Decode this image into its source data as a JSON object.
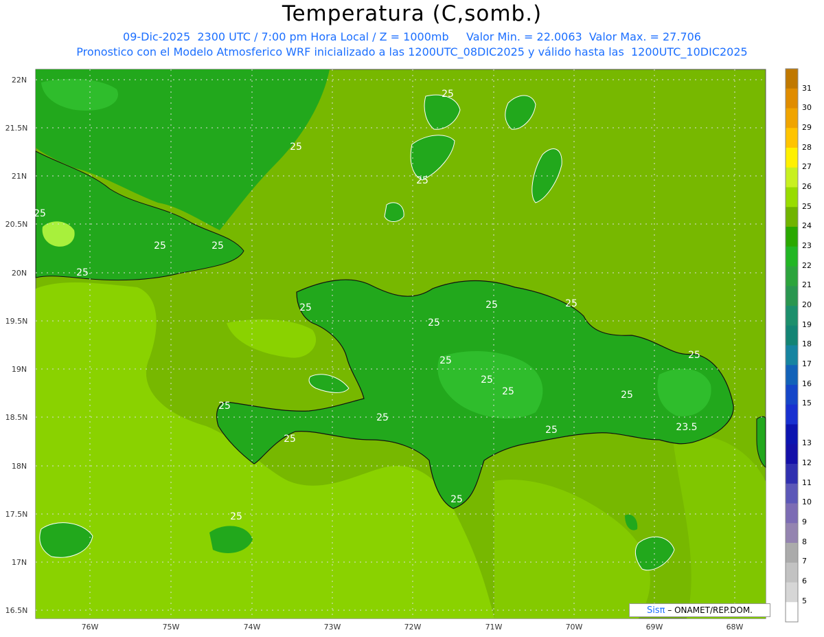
{
  "title": "Temperatura (C,somb.)",
  "subtitle_line1": "09-Dic-2025  2300 UTC / 7:00 pm Hora Local / Z = 1000mb     Valor Min. = 22.0063  Valor Max. = 27.706",
  "subtitle_line2": "Pronostico con el Modelo Atmosferico WRF inicializado a las 1200UTC_08DIC2025 y válido hasta las  1200UTC_10DIC2025",
  "credit": {
    "logo": "Sisπ",
    "text": "– ONAMET/REP.DOM."
  },
  "map": {
    "lat_ticks": [
      "22N",
      "21.5N",
      "21N",
      "20.5N",
      "20N",
      "19.5N",
      "19N",
      "18.5N",
      "18N",
      "17.5N",
      "17N",
      "16.5N"
    ],
    "lon_ticks": [
      "76W",
      "75W",
      "74W",
      "73W",
      "72W",
      "71W",
      "70W",
      "69W",
      "68W"
    ],
    "contour_labels": [
      "25",
      "25",
      "25",
      "25",
      "25",
      "25",
      "25",
      "25",
      "25",
      "25",
      "25",
      "25",
      "25",
      "25",
      "25",
      "25",
      "25",
      "25",
      "25",
      "25",
      "25",
      "25",
      "23.5"
    ],
    "colors": {
      "ocean": "#77b800",
      "warm_sea": "#8ad200",
      "land": "#22a81c",
      "cool_land": "#2fbd2c",
      "hot_spot": "#a8f03c"
    }
  },
  "colorbar": {
    "labels": [
      "31",
      "30",
      "29",
      "28",
      "27",
      "26",
      "25",
      "24",
      "23",
      "22",
      "21",
      "20",
      "19",
      "18",
      "17",
      "16",
      "15",
      "13",
      "12",
      "11",
      "10",
      "9",
      "8",
      "7",
      "6",
      "5"
    ],
    "colors": [
      "#c07800",
      "#e08c00",
      "#f0a400",
      "#ffc400",
      "#fff000",
      "#c8f020",
      "#98dc00",
      "#70b400",
      "#2aa800",
      "#22b624",
      "#2ca43c",
      "#2a9650",
      "#1c8f6c",
      "#138474",
      "#1684a0",
      "#1262b8",
      "#1546c8",
      "#1830d0",
      "#0c14b0",
      "#1410a8",
      "#3030b0",
      "#5c58b8",
      "#7c6cb4",
      "#9484b0",
      "#ababab",
      "#c2c2c2",
      "#d6d6d6",
      "#ffffff"
    ]
  }
}
